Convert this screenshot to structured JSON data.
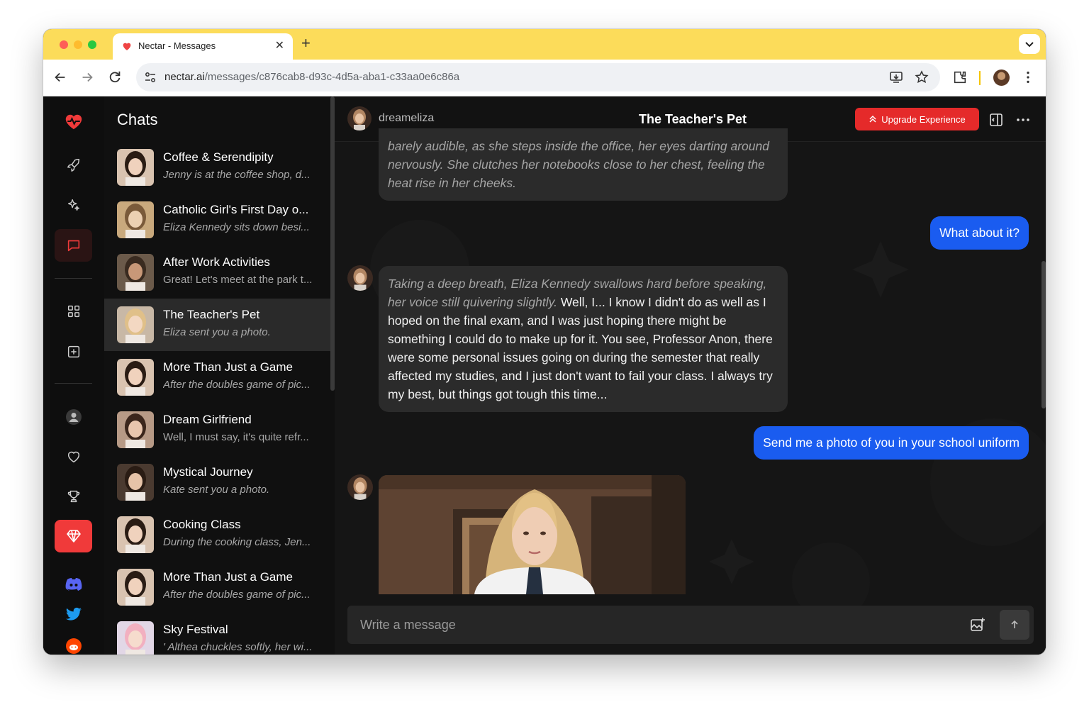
{
  "browser": {
    "tab_title": "Nectar - Messages",
    "url_host": "nectar.ai",
    "url_path": "/messages/c876cab8-d93c-4d5a-aba1-c33aa0e6c86a",
    "toolbar_icons": [
      "back-icon",
      "forward-icon",
      "reload-icon",
      "site-settings-icon",
      "install-app-icon",
      "bookmark-star-icon",
      "extensions-icon",
      "profile-avatar",
      "more-menu-icon"
    ]
  },
  "rail": {
    "items": [
      "logo-heart",
      "rocket-icon",
      "sparkles-icon",
      "chat-icon",
      "grid-icon",
      "add-square-icon",
      "profile-icon",
      "heart-icon",
      "trophy-icon",
      "gem-icon",
      "discord-icon",
      "twitter-icon",
      "reddit-icon"
    ],
    "active": "chat-icon",
    "accent": "#f03a3a"
  },
  "chatlist": {
    "title": "Chats",
    "items": [
      {
        "name": "Coffee & Serendipity",
        "preview": "Jenny is at the coffee shop, d...",
        "italic": true
      },
      {
        "name": "Catholic Girl's First Day o...",
        "preview": "Eliza Kennedy sits down besi...",
        "italic": true
      },
      {
        "name": "After Work Activities",
        "preview": "Great! Let's meet at the park t...",
        "italic": false
      },
      {
        "name": "The Teacher's Pet",
        "preview": "Eliza sent you a photo.",
        "italic": true,
        "selected": true
      },
      {
        "name": "More Than Just a Game",
        "preview": "After the doubles game of pic...",
        "italic": true
      },
      {
        "name": "Dream Girlfriend",
        "preview": "Well, I must say, it's quite refr...",
        "italic": false
      },
      {
        "name": "Mystical Journey",
        "preview": "Kate sent you a photo.",
        "italic": true
      },
      {
        "name": "Cooking Class",
        "preview": "During the cooking class, Jen...",
        "italic": true
      },
      {
        "name": "More Than Just a Game",
        "preview": "After the doubles game of pic...",
        "italic": true
      },
      {
        "name": "Sky Festival",
        "preview": "' Althea chuckles softly, her wi...",
        "italic": true
      }
    ]
  },
  "conversation": {
    "username": "dreameliza",
    "title": "The Teacher's Pet",
    "upgrade_label": "Upgrade Experience",
    "messages": {
      "ai_1_narration": "barely audible, as she steps inside the office, her eyes darting around nervously. She clutches her notebooks close to her chest, feeling the heat rise in her cheeks.",
      "user_1": "What about it?",
      "ai_2_narration": "Taking a deep breath, Eliza Kennedy swallows hard before speaking, her voice still quivering slightly.",
      "ai_2_text": " Well, I... I know I didn't do as well as I hoped on the final exam, and I was just hoping there might be something I could do to make up for it. You see, Professor Anon, there were some personal issues going on during the semester that really affected my studies, and I just don't want to fail your class. I always try my best, but things got tough this time...",
      "user_2": "Send me a photo of you in your school uniform"
    },
    "composer_placeholder": "Write a message"
  },
  "colors": {
    "tabbar": "#fcdc5a",
    "user_bubble": "#1a5cf0",
    "ai_bubble": "#2b2b2b",
    "upgrade_button": "#e52a2a"
  }
}
